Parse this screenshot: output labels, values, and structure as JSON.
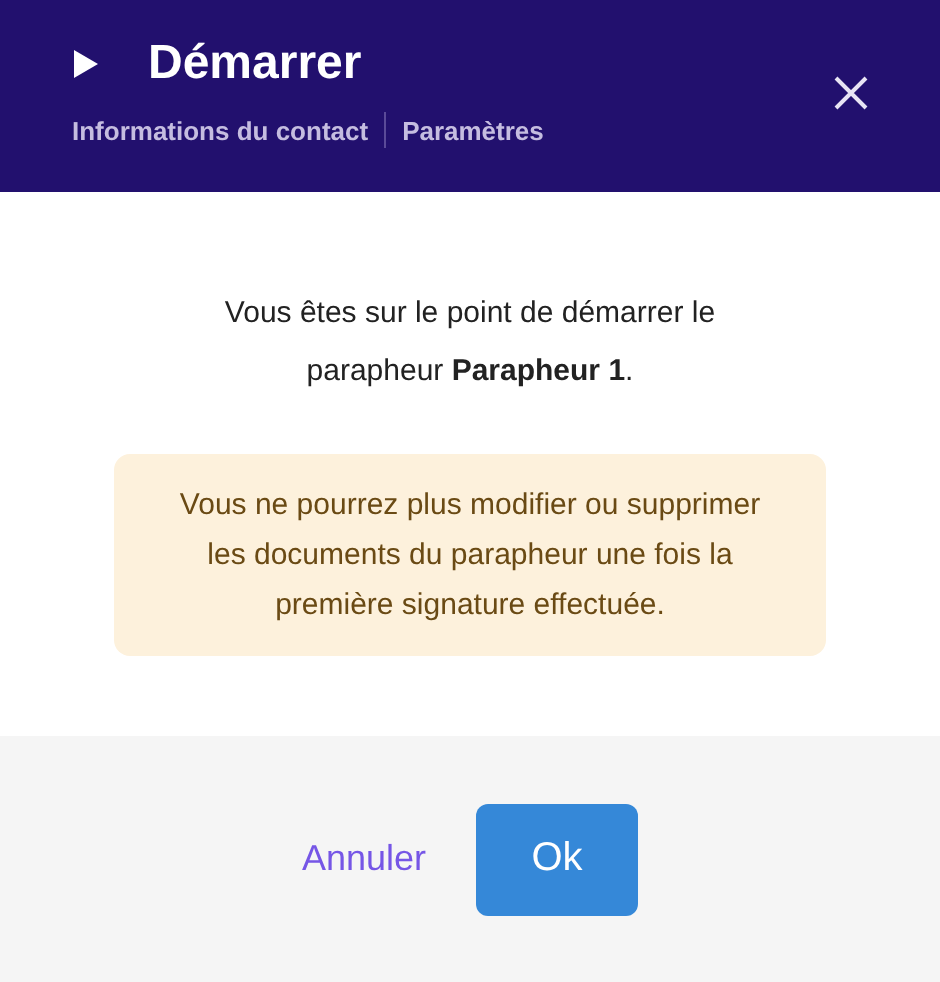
{
  "dialog": {
    "title": "Démarrer",
    "breadcrumbs": [
      "Informations du contact",
      "Paramètres"
    ],
    "message": "Vous êtes sur le point de démarrer le parapheur **Parapheur 1**.",
    "warning": "Vous ne pourrez plus modifier ou supprimer les documents du parapheur une fois la première signature effectuée.",
    "buttons": [
      {
        "label": "Annuler",
        "kind": "link"
      },
      {
        "label": "Ok",
        "kind": "primary"
      }
    ]
  }
}
